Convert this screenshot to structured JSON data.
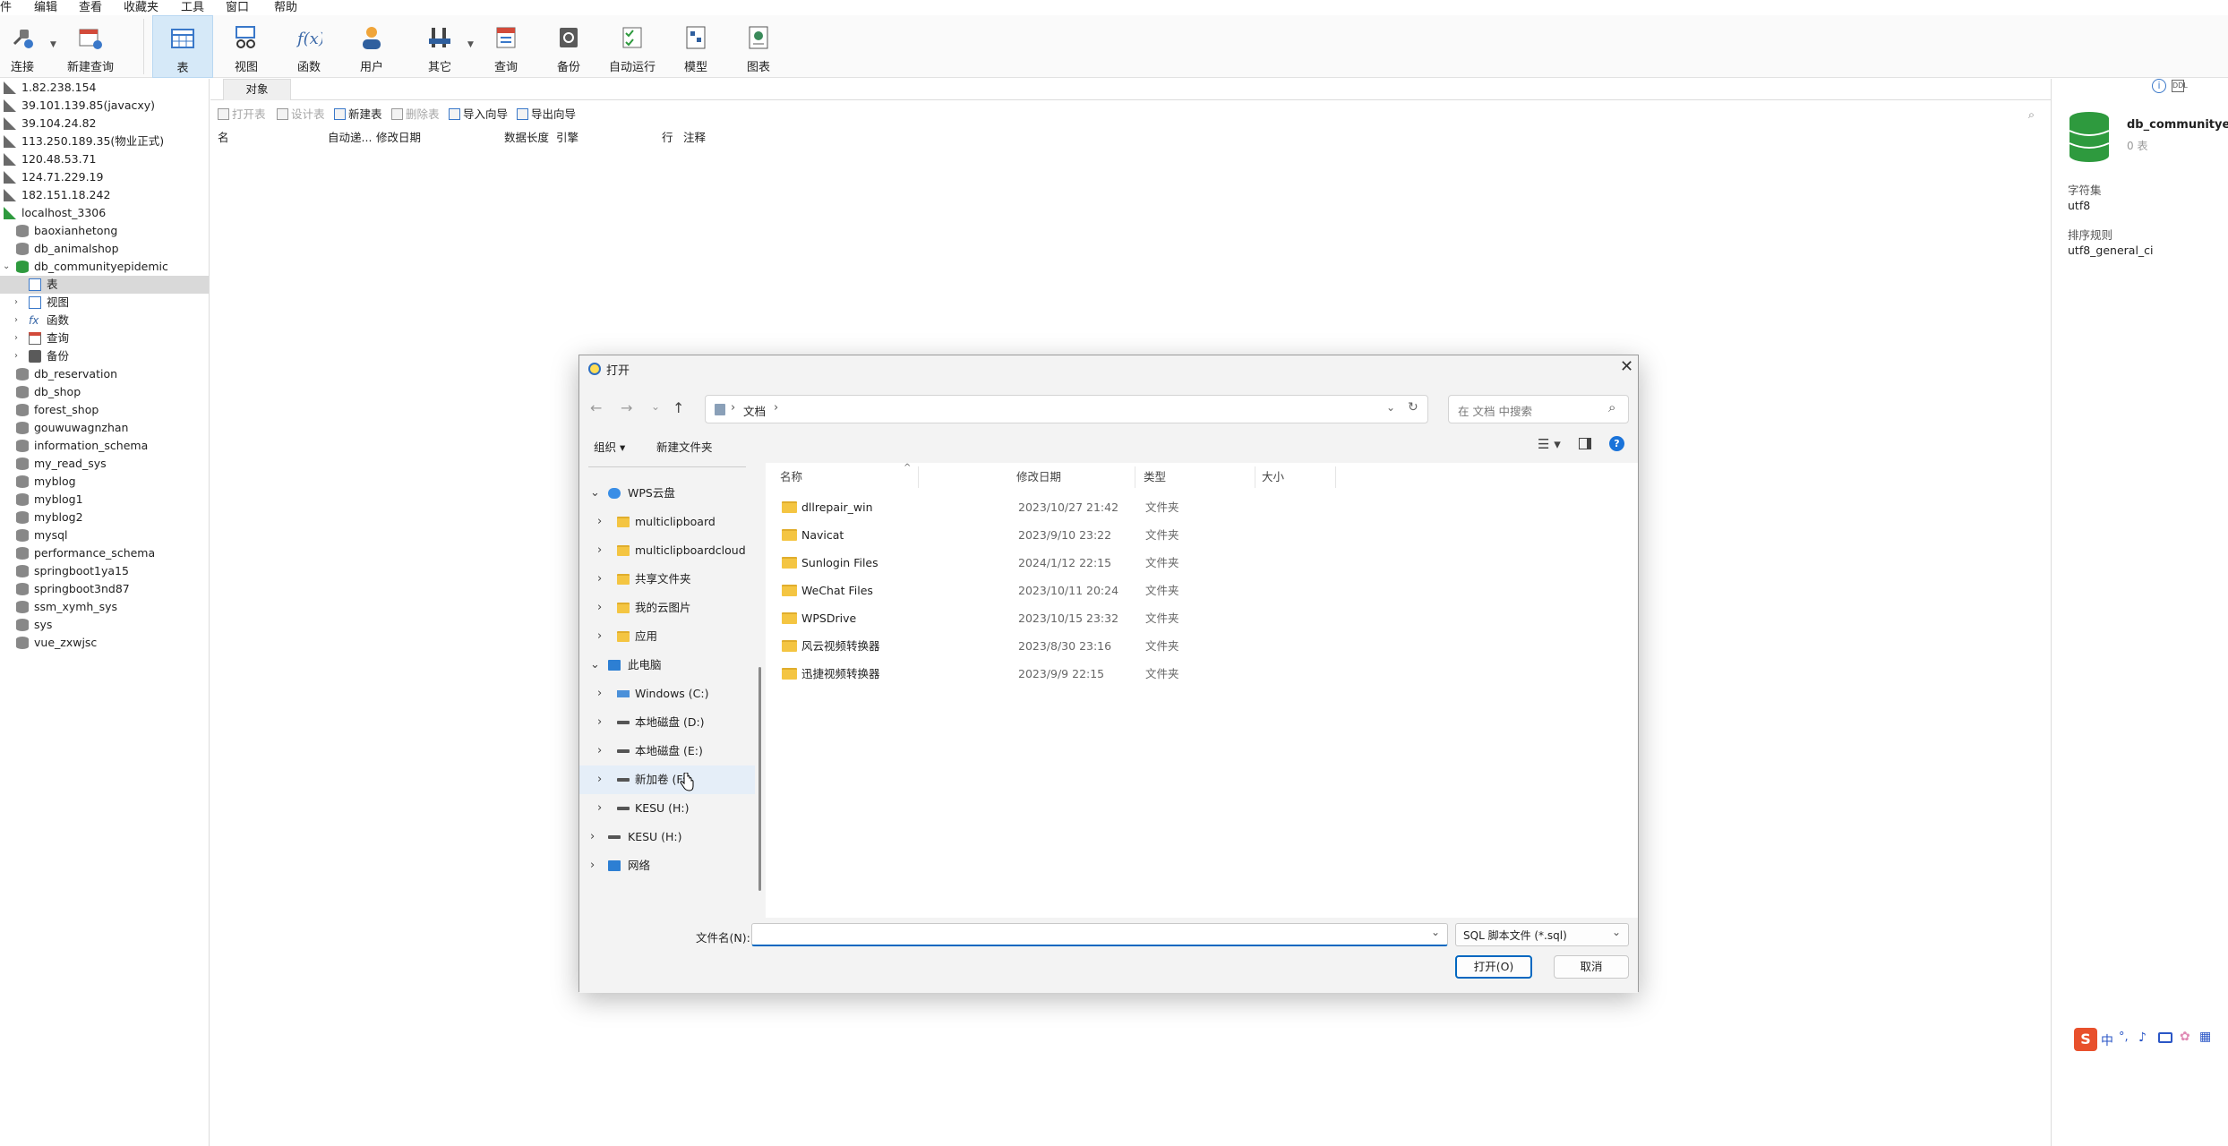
{
  "menubar": [
    "件",
    "编辑",
    "查看",
    "收藏夹",
    "工具",
    "窗口",
    "帮助"
  ],
  "toolbar": {
    "connect": "连接",
    "new_query": "新建查询",
    "table": "表",
    "view": "视图",
    "function": "函数",
    "user": "用户",
    "other": "其它",
    "query": "查询",
    "backup": "备份",
    "autorun": "自动运行",
    "model": "模型",
    "chart": "图表"
  },
  "tree": {
    "connections": [
      "1.82.238.154",
      "39.101.139.85(javacxy)",
      "39.104.24.82",
      "113.250.189.35(物业正式)",
      "120.48.53.71",
      "124.71.229.19",
      "182.151.18.242",
      "localhost_3306"
    ],
    "databases_before": [
      "baoxianhetong",
      "db_animalshop",
      "db_communityepidemic"
    ],
    "sub_items": [
      "表",
      "视图",
      "函数",
      "查询",
      "备份"
    ],
    "databases_after": [
      "db_reservation",
      "db_shop",
      "forest_shop",
      "gouwuwagnzhan",
      "information_schema",
      "my_read_sys",
      "myblog",
      "myblog1",
      "myblog2",
      "mysql",
      "performance_schema",
      "springboot1ya15",
      "springboot3nd87",
      "ssm_xymh_sys",
      "sys",
      "vue_zxwjsc"
    ]
  },
  "objects": {
    "tab": "对象",
    "actions": {
      "open_table": "打开表",
      "design_table": "设计表",
      "new_table": "新建表",
      "delete_table": "删除表",
      "import_wizard": "导入向导",
      "export_wizard": "导出向导"
    },
    "columns": {
      "name": "名",
      "auto_inc": "自动递...",
      "modified": "修改日期",
      "data_len": "数据长度",
      "engine": "引擎",
      "rows": "行",
      "comment": "注释"
    }
  },
  "info": {
    "db_name": "db_communityepi",
    "table_count": "0 表",
    "charset_label": "字符集",
    "charset": "utf8",
    "collation_label": "排序规则",
    "collation": "utf8_general_ci"
  },
  "dialog": {
    "title": "打开",
    "breadcrumb": "文档",
    "search_placeholder": "在 文档 中搜索",
    "organize": "组织",
    "new_folder": "新建文件夹",
    "nav": {
      "wps_cloud": "WPS云盘",
      "cloud_children": [
        "multiclipboard",
        "multiclipboardcloud",
        "共享文件夹",
        "我的云图片",
        "应用"
      ],
      "this_pc": "此电脑",
      "drives": [
        "Windows (C:)",
        "本地磁盘 (D:)",
        "本地磁盘 (E:)",
        "新加卷 (F:)",
        "KESU  (H:)"
      ],
      "kesu": "KESU  (H:)",
      "network": "网络"
    },
    "headers": {
      "name": "名称",
      "modified": "修改日期",
      "type": "类型",
      "size": "大小"
    },
    "files": [
      {
        "name": "dllrepair_win",
        "date": "2023/10/27 21:42",
        "type": "文件夹"
      },
      {
        "name": "Navicat",
        "date": "2023/9/10 23:22",
        "type": "文件夹"
      },
      {
        "name": "Sunlogin Files",
        "date": "2024/1/12 22:15",
        "type": "文件夹"
      },
      {
        "name": "WeChat Files",
        "date": "2023/10/11 20:24",
        "type": "文件夹"
      },
      {
        "name": "WPSDrive",
        "date": "2023/10/15 23:32",
        "type": "文件夹"
      },
      {
        "name": "风云视频转换器",
        "date": "2023/8/30 23:16",
        "type": "文件夹"
      },
      {
        "name": "迅捷视频转换器",
        "date": "2023/9/9 22:15",
        "type": "文件夹"
      }
    ],
    "filename_label": "文件名(N):",
    "filename_value": "",
    "filter": "SQL 脚本文件 (*.sql)",
    "open_btn": "打开(O)",
    "cancel_btn": "取消"
  },
  "ime": {
    "lang": "中"
  }
}
